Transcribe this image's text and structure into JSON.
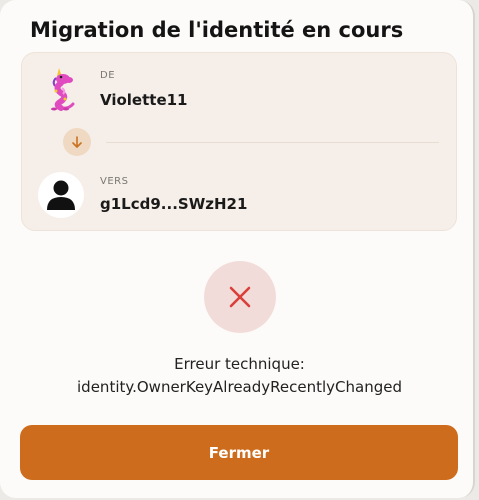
{
  "dialog": {
    "title": "Migration de l'identité en cours"
  },
  "migration": {
    "from": {
      "label": "DE",
      "name": "Violette11",
      "avatar_icon": "unicorn-dragon-avatar"
    },
    "arrow_icon": "arrow-down-icon",
    "to": {
      "label": "VERS",
      "name": "g1Lcd9...SWzH21",
      "avatar_icon": "person-silhouette-icon"
    }
  },
  "error": {
    "icon": "close-x-icon",
    "line1": "Erreur technique:",
    "line2": "identity.OwnerKeyAlreadyRecentlyChanged"
  },
  "actions": {
    "close_label": "Fermer"
  },
  "colors": {
    "accent": "#cd6c1d",
    "error_icon": "#d9403a",
    "error_bg": "#f2dcd9",
    "card_bg": "#f6efe9",
    "arrow_bg": "#efd9c2"
  }
}
